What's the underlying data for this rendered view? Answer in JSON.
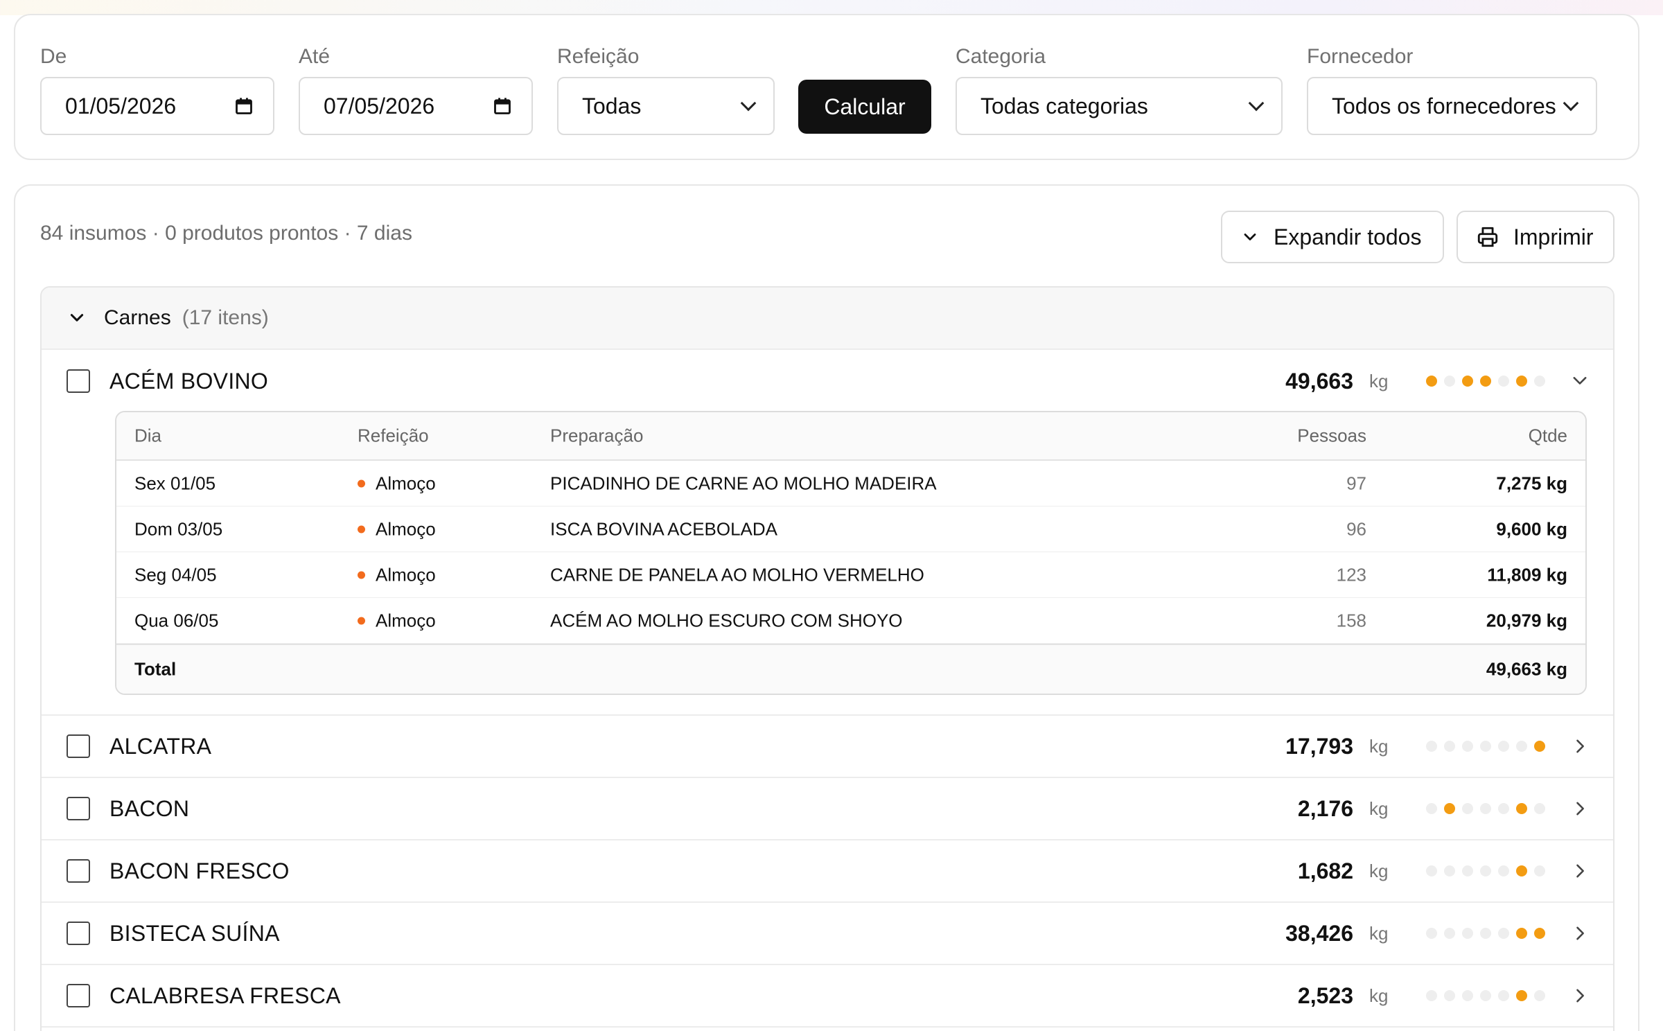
{
  "filters": {
    "de": {
      "label": "De",
      "value": "01/05/2026"
    },
    "ate": {
      "label": "Até",
      "value": "07/05/2026"
    },
    "refeicao": {
      "label": "Refeição",
      "value": "Todas"
    },
    "calcular_label": "Calcular",
    "categoria": {
      "label": "Categoria",
      "value": "Todas categorias"
    },
    "fornecedor": {
      "label": "Fornecedor",
      "value": "Todos os fornecedores"
    }
  },
  "results": {
    "summary": "84 insumos · 0 produtos prontos · 7 dias",
    "expand_all_label": "Expandir todos",
    "print_label": "Imprimir"
  },
  "category": {
    "name": "Carnes",
    "count": "(17 itens)",
    "items": [
      {
        "name": "ACÉM BOVINO",
        "qty": "49,663",
        "unit": "kg",
        "days": [
          1,
          0,
          1,
          1,
          0,
          1,
          0
        ],
        "expanded": true
      },
      {
        "name": "ALCATRA",
        "qty": "17,793",
        "unit": "kg",
        "days": [
          0,
          0,
          0,
          0,
          0,
          0,
          1
        ]
      },
      {
        "name": "BACON",
        "qty": "2,176",
        "unit": "kg",
        "days": [
          0,
          1,
          0,
          0,
          0,
          1,
          0
        ]
      },
      {
        "name": "BACON FRESCO",
        "qty": "1,682",
        "unit": "kg",
        "days": [
          0,
          0,
          0,
          0,
          0,
          1,
          0
        ]
      },
      {
        "name": "BISTECA SUÍNA",
        "qty": "38,426",
        "unit": "kg",
        "days": [
          0,
          0,
          0,
          0,
          0,
          1,
          1
        ]
      },
      {
        "name": "CALABRESA FRESCA",
        "qty": "2,523",
        "unit": "kg",
        "days": [
          0,
          0,
          0,
          0,
          0,
          1,
          0
        ]
      }
    ]
  },
  "detail": {
    "headers": {
      "dia": "Dia",
      "refeicao": "Refeição",
      "preparacao": "Preparação",
      "pessoas": "Pessoas",
      "qtde": "Qtde"
    },
    "rows": [
      {
        "dia": "Sex 01/05",
        "refeicao": "Almoço",
        "preparacao": "PICADINHO DE CARNE AO MOLHO MADEIRA",
        "pessoas": "97",
        "qtde": "7,275 kg"
      },
      {
        "dia": "Dom 03/05",
        "refeicao": "Almoço",
        "preparacao": "ISCA BOVINA ACEBOLADA",
        "pessoas": "96",
        "qtde": "9,600 kg"
      },
      {
        "dia": "Seg 04/05",
        "refeicao": "Almoço",
        "preparacao": "CARNE DE PANELA AO MOLHO VERMELHO",
        "pessoas": "123",
        "qtde": "11,809 kg"
      },
      {
        "dia": "Qua 06/05",
        "refeicao": "Almoço",
        "preparacao": "ACÉM AO MOLHO ESCURO COM SHOYO",
        "pessoas": "158",
        "qtde": "20,979 kg"
      }
    ],
    "total_label": "Total",
    "total_value": "49,663 kg"
  },
  "colors": {
    "accent_dot": "#f39c12",
    "meal_dot": "#f26b1d",
    "primary_button": "#111111"
  }
}
